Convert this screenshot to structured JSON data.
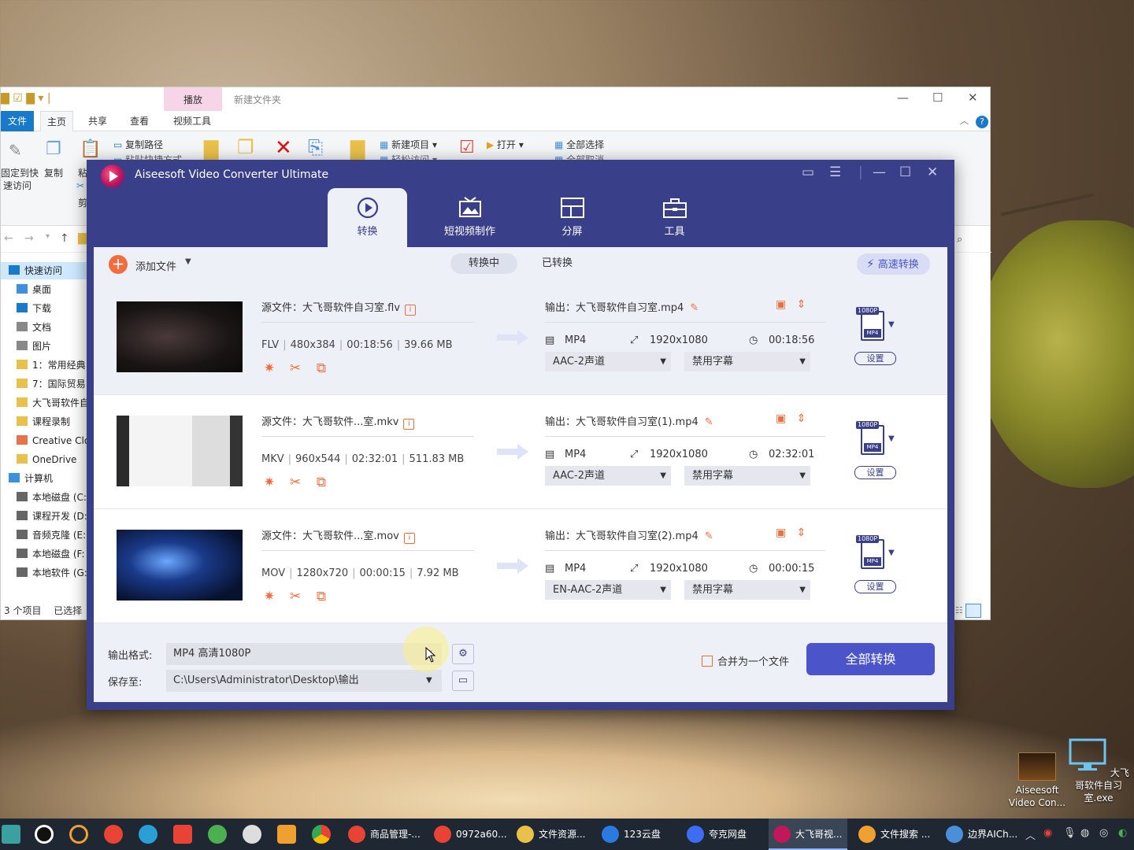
{
  "explorer": {
    "title": "新建文件夹",
    "play_tab": "播放",
    "tabs": [
      "文件",
      "主页",
      "共享",
      "查看",
      "视频工具"
    ],
    "ribbon": {
      "pin_label_1": "固定到快",
      "pin_label_2": "速访问",
      "copy": "复制",
      "paste": "粘",
      "cut": "剪",
      "copy_path": "复制路径",
      "paste_shortcut": "粘贴快捷方式",
      "new_item": "新建项目",
      "easy_access": "轻松访问",
      "open": "打开",
      "select_all": "全部选择",
      "select_none": "全部取消"
    },
    "sidebar": [
      {
        "label": "快速访问",
        "color": "#1979ca"
      },
      {
        "label": "桌面",
        "color": "#3d8fe0"
      },
      {
        "label": "下载",
        "color": "#1979ca"
      },
      {
        "label": "文档",
        "color": "#888888"
      },
      {
        "label": "图片",
        "color": "#888888"
      },
      {
        "label": "1：常用经典",
        "color": "#e8c04a"
      },
      {
        "label": "7：国际贸易",
        "color": "#e8c04a"
      },
      {
        "label": "大飞哥软件自",
        "color": "#e8c04a"
      },
      {
        "label": "课程录制",
        "color": "#e8c04a"
      },
      {
        "label": "Creative Clou",
        "color": "#e8734a"
      },
      {
        "label": "OneDrive",
        "color": "#e8c04a"
      },
      {
        "label": "计算机",
        "color": "#3d8fe0"
      },
      {
        "label": "本地磁盘 (C:",
        "color": "#666666"
      },
      {
        "label": "课程开发 (D:",
        "color": "#666666"
      },
      {
        "label": "音频克隆 (E:",
        "color": "#666666"
      },
      {
        "label": "本地磁盘 (F:",
        "color": "#666666"
      },
      {
        "label": "本地软件 (G:",
        "color": "#666666"
      }
    ],
    "status_count": "3 个项目",
    "status_selected": "已选择"
  },
  "app": {
    "title": "Aiseesoft Video Converter Ultimate",
    "accent": "#3a3f8a",
    "tabs": [
      {
        "label": "转换",
        "icon": "convert-icon"
      },
      {
        "label": "短视频制作",
        "icon": "mv-icon"
      },
      {
        "label": "分屏",
        "icon": "collage-icon"
      },
      {
        "label": "工具",
        "icon": "toolbox-icon"
      }
    ],
    "add_files": "添加文件",
    "sub_tabs": {
      "converting": "转换中",
      "converted": "已转换"
    },
    "fast_convert": "高速转换",
    "files": [
      {
        "source": "源文件：大飞哥软件自习室.flv",
        "fmt": "FLV",
        "res": "480x384",
        "duration": "00:18:56",
        "size": "39.66 MB",
        "output": "输出：大飞哥软件自习室.mp4",
        "out_fmt": "MP4",
        "out_res": "1920x1080",
        "out_duration": "00:18:56",
        "audio": "AAC-2声道",
        "subtitle": "禁用字幕",
        "badge": "1080P",
        "badge_fmt": "MP4",
        "settings": "设置"
      },
      {
        "source": "源文件：大飞哥软件...室.mkv",
        "fmt": "MKV",
        "res": "960x544",
        "duration": "02:32:01",
        "size": "511.83 MB",
        "output": "输出：大飞哥软件自习室(1).mp4",
        "out_fmt": "MP4",
        "out_res": "1920x1080",
        "out_duration": "02:32:01",
        "audio": "AAC-2声道",
        "subtitle": "禁用字幕",
        "badge": "1080P",
        "badge_fmt": "MP4",
        "settings": "设置"
      },
      {
        "source": "源文件：大飞哥软件...室.mov",
        "fmt": "MOV",
        "res": "1280x720",
        "duration": "00:00:15",
        "size": "7.92 MB",
        "output": "输出：大飞哥软件自习室(2).mp4",
        "out_fmt": "MP4",
        "out_res": "1920x1080",
        "out_duration": "00:00:15",
        "audio": "EN-AAC-2声道",
        "subtitle": "禁用字幕",
        "badge": "1080P",
        "badge_fmt": "MP4",
        "settings": "设置"
      }
    ],
    "output_format_label": "输出格式:",
    "output_format_value": "MP4 高清1080P",
    "save_to_label": "保存至:",
    "save_to_value": "C:\\Users\\Administrator\\Desktop\\输出",
    "merge_label": "合并为一个文件",
    "convert_all": "全部转换"
  },
  "desktop": [
    {
      "label": "Aiseesoft Video Con..."
    },
    {
      "label": "大飞哥软件自习室.exe"
    }
  ],
  "taskbar": {
    "apps": [
      {
        "label": "商品管理-...",
        "color": "#e94335"
      },
      {
        "label": "0972a60...",
        "color": "#e94335"
      },
      {
        "label": "文件资源...",
        "color": "#e8c04a"
      },
      {
        "label": "123云盘",
        "color": "#2a7ae2"
      },
      {
        "label": "夸克网盘",
        "color": "#3d6df2"
      },
      {
        "label": "大飞哥视...",
        "color": "#c2185b"
      },
      {
        "label": "文件搜索 ...",
        "color": "#f0a030"
      },
      {
        "label": "边界AICh...",
        "color": "#4a90d9"
      }
    ]
  }
}
